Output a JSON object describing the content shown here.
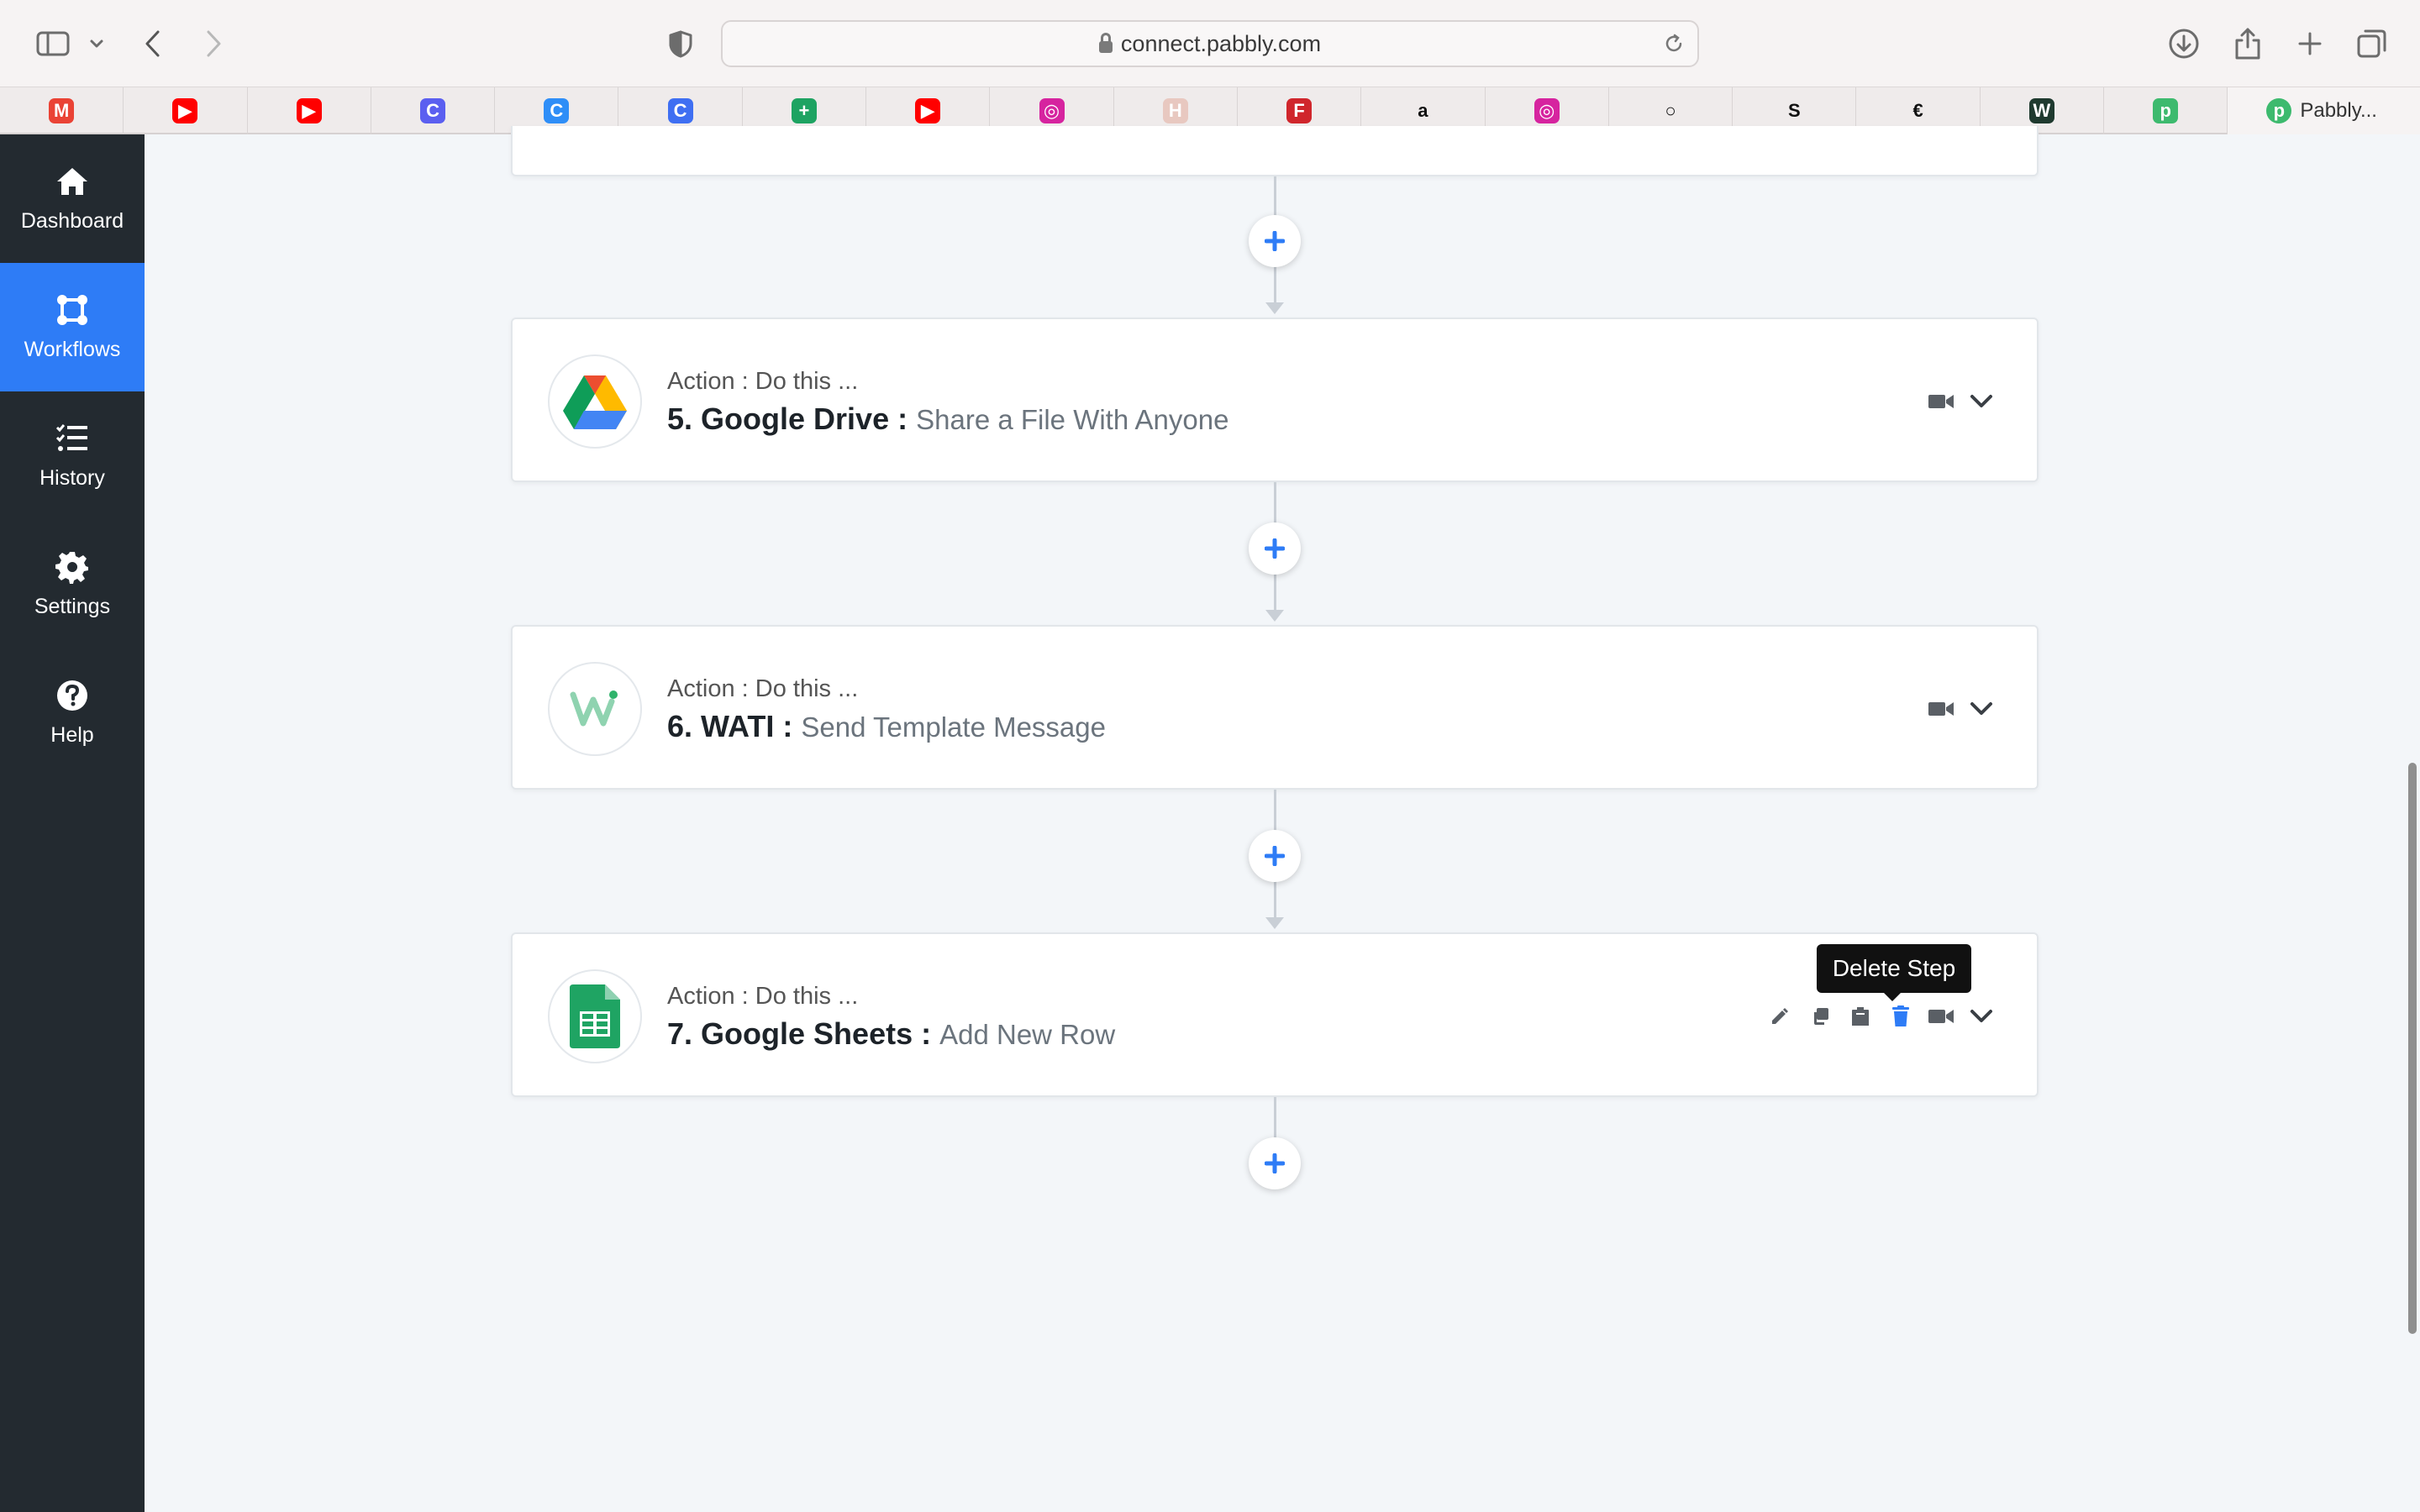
{
  "browser": {
    "url": "connect.pabbly.com",
    "bookmarks": [
      {
        "icon": "gmail-icon",
        "glyph": "M",
        "color": "#ea4335"
      },
      {
        "icon": "youtube-icon",
        "glyph": "▶",
        "color": "#ff0000"
      },
      {
        "icon": "youtube-icon",
        "glyph": "▶",
        "color": "#ff0000"
      },
      {
        "icon": "canva-icon",
        "glyph": "C",
        "color": "#5b5ff0"
      },
      {
        "icon": "canva-icon",
        "glyph": "C",
        "color": "#2f8ef7"
      },
      {
        "icon": "canva-icon",
        "glyph": "C",
        "color": "#3f6ff2"
      },
      {
        "icon": "sheets-plus-icon",
        "glyph": "+",
        "color": "#1ea362"
      },
      {
        "icon": "youtube-icon",
        "glyph": "▶",
        "color": "#ff0000"
      },
      {
        "icon": "instagram-icon",
        "glyph": "◎",
        "color": "#d6249f"
      },
      {
        "icon": "handwritten-logo-icon",
        "glyph": "H",
        "color": "#e8c8c0"
      },
      {
        "icon": "fii-icon",
        "glyph": "F",
        "color": "#d0262c"
      },
      {
        "icon": "amazon-icon",
        "glyph": "a",
        "color": "#ffffff"
      },
      {
        "icon": "instagram-icon",
        "glyph": "◎",
        "color": "#d6249f"
      },
      {
        "icon": "ring-icon",
        "glyph": "○",
        "color": "#ffffff"
      },
      {
        "icon": "s-logo-icon",
        "glyph": "S",
        "color": "#ffffff"
      },
      {
        "icon": "euro-logo-icon",
        "glyph": "€",
        "color": "#ffffff"
      },
      {
        "icon": "w-logo-icon",
        "glyph": "W",
        "color": "#1f3a2f"
      },
      {
        "icon": "pabbly-icon",
        "glyph": "p",
        "color": "#3dba6e"
      }
    ],
    "last_tab_title": "Pabbly..."
  },
  "sidebar": {
    "items": [
      {
        "label": "Dashboard",
        "icon": "home-icon",
        "active": false
      },
      {
        "label": "Workflows",
        "icon": "workflows-icon",
        "active": true
      },
      {
        "label": "History",
        "icon": "history-list-icon",
        "active": false
      },
      {
        "label": "Settings",
        "icon": "gear-icon",
        "active": false
      },
      {
        "label": "Help",
        "icon": "help-icon",
        "active": false
      }
    ]
  },
  "steps": [
    {
      "subtitle": "Action : Do this ...",
      "number": "5.",
      "app": "Google Drive :",
      "event": "Share a File With Anyone",
      "logo": "google-drive-icon"
    },
    {
      "subtitle": "Action : Do this ...",
      "number": "6.",
      "app": "WATI :",
      "event": "Send Template Message",
      "logo": "wati-icon"
    },
    {
      "subtitle": "Action : Do this ...",
      "number": "7.",
      "app": "Google Sheets :",
      "event": "Add New Row",
      "logo": "google-sheets-icon"
    }
  ],
  "tooltip": {
    "text": "Delete Step"
  },
  "colors": {
    "accent": "#2e7cf6",
    "sidebar": "#232a30",
    "canvas": "#f3f6f9"
  }
}
